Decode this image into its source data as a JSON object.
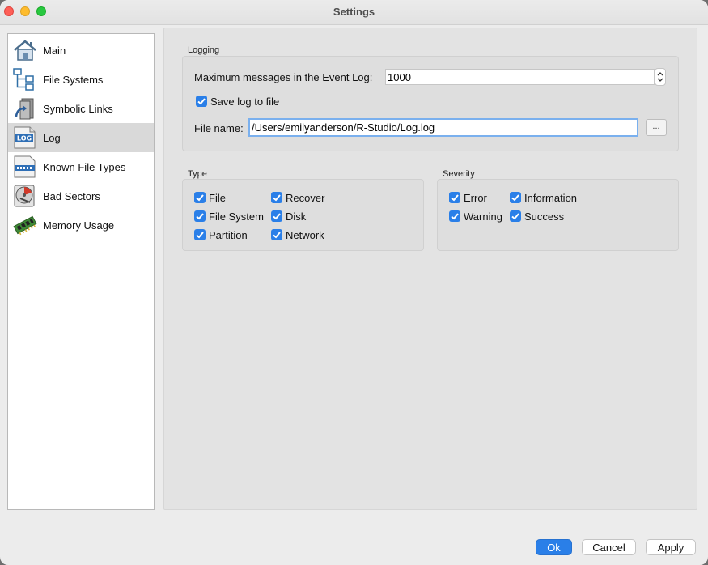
{
  "window": {
    "title": "Settings"
  },
  "sidebar": {
    "items": [
      {
        "label": "Main",
        "icon": "house-icon"
      },
      {
        "label": "File Systems",
        "icon": "tree-structure-icon"
      },
      {
        "label": "Symbolic Links",
        "icon": "symbolic-link-icon"
      },
      {
        "label": "Log",
        "icon": "log-document-icon",
        "selected": true
      },
      {
        "label": "Known File Types",
        "icon": "file-types-icon"
      },
      {
        "label": "Bad Sectors",
        "icon": "bad-sectors-disk-icon"
      },
      {
        "label": "Memory Usage",
        "icon": "memory-chip-icon"
      }
    ]
  },
  "logging": {
    "title": "Logging",
    "max_messages_label": "Maximum messages in the Event Log:",
    "max_messages_value": "1000",
    "save_to_file_label": "Save log to file",
    "save_to_file_checked": true,
    "file_name_label": "File name:",
    "file_name_value": "/Users/emilyanderson/R-Studio/Log.log",
    "browse_label": "..."
  },
  "type_group": {
    "title": "Type",
    "options": [
      {
        "label": "File",
        "checked": true
      },
      {
        "label": "Recover",
        "checked": true
      },
      {
        "label": "File System",
        "checked": true
      },
      {
        "label": "Disk",
        "checked": true
      },
      {
        "label": "Partition",
        "checked": true
      },
      {
        "label": "Network",
        "checked": true
      }
    ]
  },
  "severity_group": {
    "title": "Severity",
    "options": [
      {
        "label": "Error",
        "checked": true
      },
      {
        "label": "Information",
        "checked": true
      },
      {
        "label": "Warning",
        "checked": true
      },
      {
        "label": "Success",
        "checked": true
      }
    ]
  },
  "buttons": {
    "ok": "Ok",
    "cancel": "Cancel",
    "apply": "Apply"
  },
  "colors": {
    "accent": "#2a7fe8",
    "selection": "#d9d9d9"
  }
}
